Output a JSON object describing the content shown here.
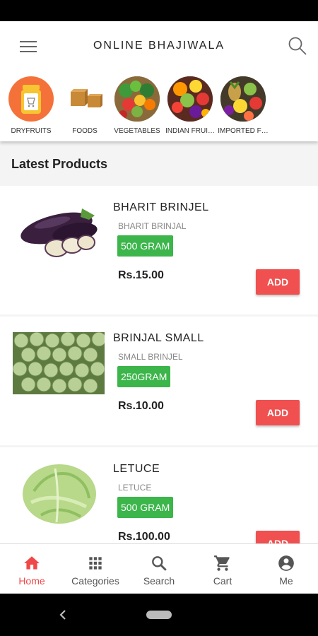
{
  "app": {
    "title": "ONLINE BHAJIWALA"
  },
  "categories": [
    {
      "label": "DRYFRUITS",
      "icon": "dryfruits-jar-icon"
    },
    {
      "label": "FOODS",
      "icon": "jaggery-blocks-icon"
    },
    {
      "label": "VEGETABLES",
      "icon": "vegetables-basket-icon"
    },
    {
      "label": "INDIAN FRUI…",
      "icon": "indian-fruits-icon"
    },
    {
      "label": "IMPORTED F…",
      "icon": "imported-fruits-icon"
    }
  ],
  "section": {
    "latest_title": "Latest Products"
  },
  "products": [
    {
      "name": "BHARIT BRINJEL",
      "subtitle": "BHARIT BRINJAL",
      "quantity": "500 GRAM",
      "price": "Rs.15.00",
      "add_label": "ADD"
    },
    {
      "name": "BRINJAL SMALL",
      "subtitle": "SMALL BRINJEL",
      "quantity": "250GRAM",
      "price": "Rs.10.00",
      "add_label": "ADD"
    },
    {
      "name": "LETUCE",
      "subtitle": "LETUCE",
      "quantity": "500 GRAM",
      "price": "Rs.100.00",
      "add_label": "ADD"
    }
  ],
  "bottom_nav": [
    {
      "label": "Home",
      "icon": "home-icon",
      "active": true
    },
    {
      "label": "Categories",
      "icon": "grid-icon",
      "active": false
    },
    {
      "label": "Search",
      "icon": "search-icon",
      "active": false
    },
    {
      "label": "Cart",
      "icon": "cart-icon",
      "active": false
    },
    {
      "label": "Me",
      "icon": "account-icon",
      "active": false
    }
  ],
  "colors": {
    "accent": "#f04848",
    "badge": "#3cb54b",
    "add_button": "#f05050"
  }
}
